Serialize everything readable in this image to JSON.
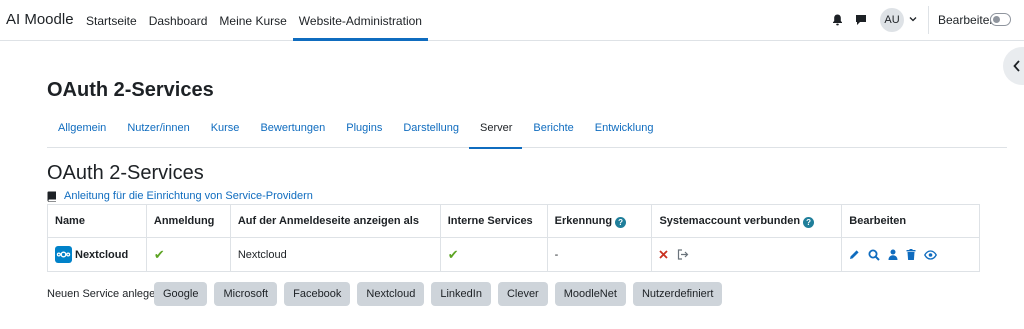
{
  "navbar": {
    "brand": "AI Moodle",
    "items": [
      {
        "label": "Startseite"
      },
      {
        "label": "Dashboard"
      },
      {
        "label": "Meine Kurse"
      },
      {
        "label": "Website-Administration",
        "active": true
      }
    ],
    "avatar_initials": "AU",
    "edit_mode_label": "Bearbeiten",
    "icons": {
      "notifications": "bell-icon",
      "messages": "chat-icon",
      "user_menu": "chevron-down-icon"
    }
  },
  "page": {
    "title": "OAuth 2-Services",
    "tabs": [
      {
        "label": "Allgemein"
      },
      {
        "label": "Nutzer/innen"
      },
      {
        "label": "Kurse"
      },
      {
        "label": "Bewertungen"
      },
      {
        "label": "Plugins"
      },
      {
        "label": "Darstellung"
      },
      {
        "label": "Server",
        "active": true
      },
      {
        "label": "Berichte"
      },
      {
        "label": "Entwicklung"
      }
    ],
    "section_title": "OAuth 2-Services",
    "help_link": "Anleitung für die Einrichtung von Service-Providern"
  },
  "table": {
    "headers": {
      "name": "Name",
      "login": "Anmeldung",
      "show_on_login": "Auf der Anmeldeseite anzeigen als",
      "internal_services": "Interne Services",
      "discovery": "Erkennung",
      "system_account": "Systemaccount verbunden",
      "edit": "Bearbeiten"
    },
    "rows": [
      {
        "name": "Nextcloud",
        "show_on_login": "Nextcloud",
        "discovery": "-",
        "login_enabled": true,
        "internal_enabled": true,
        "system_account_connected": false,
        "actions": [
          "edit-icon",
          "search-icon",
          "user-icon",
          "delete-icon",
          "eye-icon"
        ]
      }
    ]
  },
  "create": {
    "label": "Neuen Service anlegen:",
    "buttons": [
      "Google",
      "Microsoft",
      "Facebook",
      "Nextcloud",
      "LinkedIn",
      "Clever",
      "MoodleNet",
      "Nutzerdefiniert"
    ]
  },
  "colors": {
    "primary": "#0f6cbf",
    "info": "#1f7e9a",
    "success": "#5da423",
    "danger": "#ca3120"
  }
}
